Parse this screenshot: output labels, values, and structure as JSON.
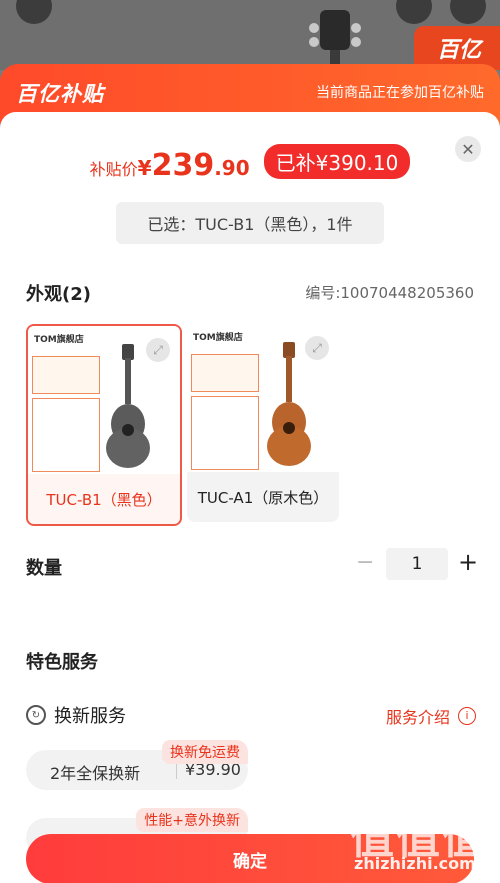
{
  "background": {
    "badge_text": "百亿"
  },
  "banner": {
    "logo": "百亿补贴",
    "note": "当前商品正在参加百亿补贴"
  },
  "price": {
    "label": "补贴价",
    "currency": "¥",
    "integer": "239",
    "decimal": ".90",
    "saved": "已补¥390.10"
  },
  "selected_text": "已选：TUC-B1（黑色），1件",
  "appearance": {
    "title": "外观(2)",
    "code": "编号:10070448205360"
  },
  "variants": [
    {
      "label": "TUC-B1（黑色）",
      "brand": "TOM旗舰店",
      "selected": true
    },
    {
      "label": "TUC-A1（原木色）",
      "brand": "TOM旗舰店",
      "selected": false
    }
  ],
  "quantity": {
    "label": "数量",
    "value": "1",
    "minus": "−",
    "plus": "+"
  },
  "services": {
    "title": "特色服务",
    "item_label": "换新服务",
    "link": "服务介绍",
    "options": [
      {
        "text": "2年全保换新",
        "price": "¥39.90",
        "tag": "换新免运费"
      },
      {
        "text": "",
        "price": "",
        "tag": "性能+意外换新"
      }
    ]
  },
  "confirm": "确定",
  "watermark": {
    "big": "值值值",
    "small": "zhizhizhi.com"
  },
  "colors": {
    "accent": "#e8341c",
    "banner": "#ff4a2a",
    "confirm": "#ff3c3c"
  }
}
